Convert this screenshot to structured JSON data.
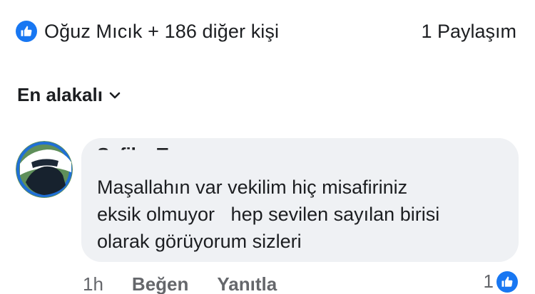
{
  "reactions": {
    "icon": "like-icon",
    "summary": "Oğuz Mıcık + 186 diğer kişi",
    "shares": "1 Paylaşım"
  },
  "sort": {
    "label": "En alakalı",
    "icon": "chevron-down-icon"
  },
  "comment": {
    "author": "Sefika T",
    "lines": [
      "Maşallahın var vekilim hiç misafiriniz",
      "eksik olmuyor   hep sevilen sayılan birisi",
      "olarak görüyorum sizleri"
    ],
    "time": "1h",
    "like_label": "Beğen",
    "reply_label": "Yanıtla",
    "reaction_count": "1",
    "reaction_icon": "like-icon"
  },
  "colors": {
    "like_blue": "#1877f2",
    "bubble_bg": "#eff1f4",
    "secondary_text": "#65676b"
  }
}
